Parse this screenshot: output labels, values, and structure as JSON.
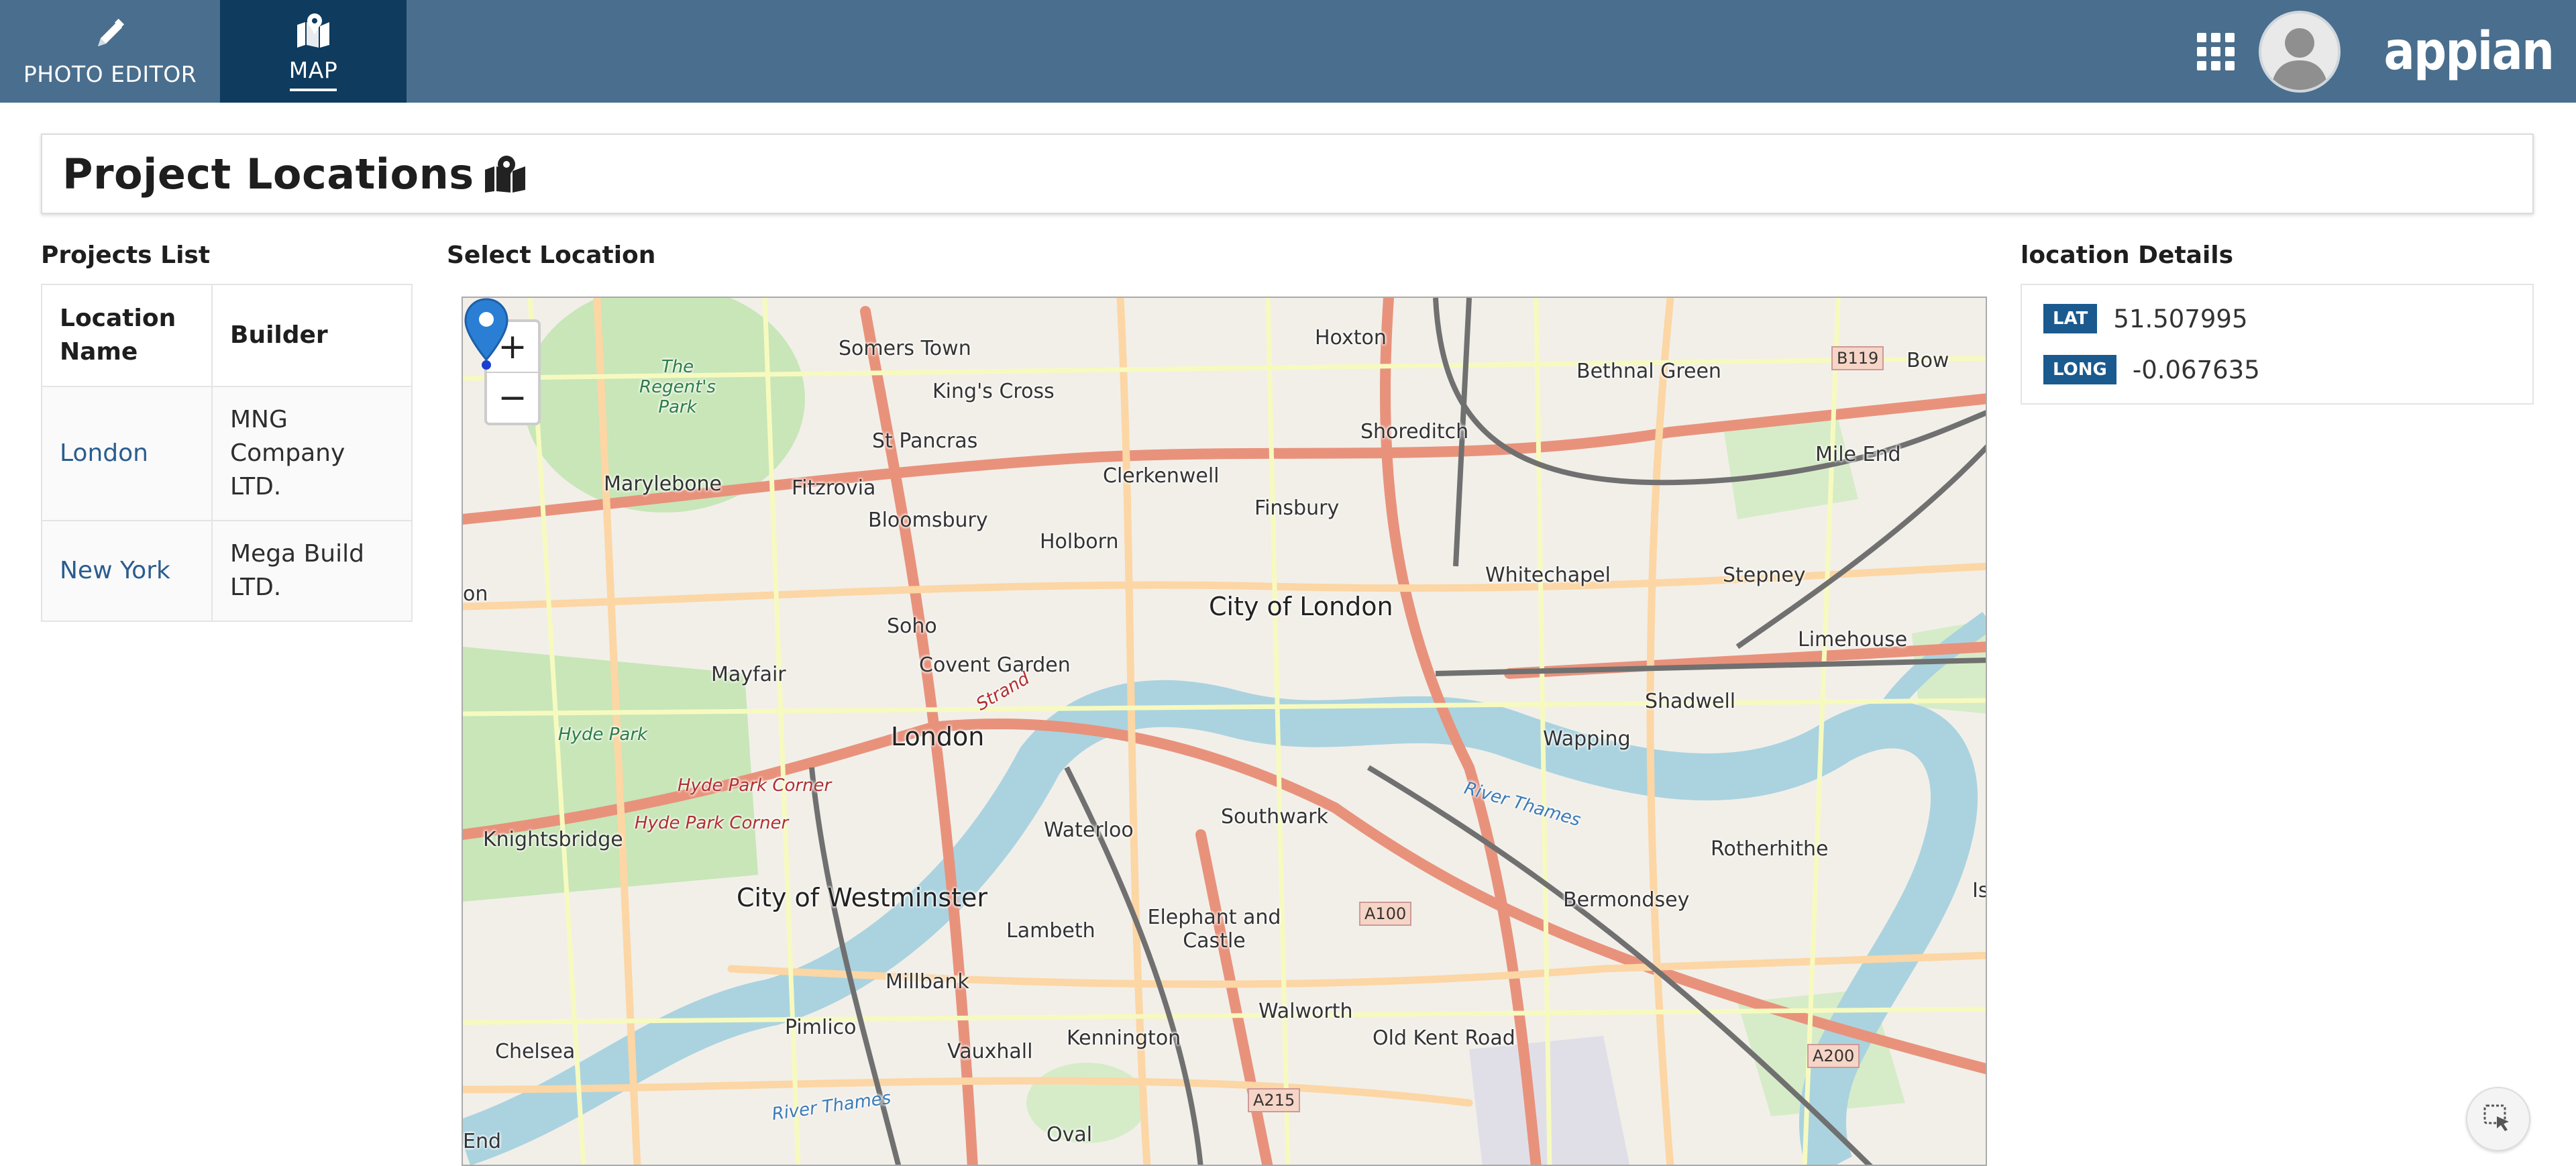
{
  "nav": {
    "tabs": [
      {
        "label": "PHOTO EDITOR",
        "icon": "pencil-icon"
      },
      {
        "label": "MAP",
        "icon": "map-icon",
        "active": true
      }
    ],
    "apps_icon": "grid-icon",
    "logo_text": "appian"
  },
  "page": {
    "title": "Project Locations"
  },
  "projects": {
    "section_label": "Projects List",
    "columns": [
      "Location Name",
      "Builder"
    ],
    "rows": [
      {
        "location": "London",
        "builder": "MNG Company LTD."
      },
      {
        "location": "New York",
        "builder": "Mega Build LTD."
      }
    ]
  },
  "map": {
    "section_label": "Select Location",
    "zoom_in": "+",
    "zoom_out": "−",
    "labels": {
      "somers_town": "Somers Town",
      "hoxton": "Hoxton",
      "bethnal_green": "Bethnal Green",
      "bow": "Bow",
      "kings_cross": "King's Cross",
      "regents_park": "The Regent's Park",
      "shoreditch": "Shoreditch",
      "st_pancras": "St Pancras",
      "mile_end": "Mile End",
      "marylebone": "Marylebone",
      "fitzrovia": "Fitzrovia",
      "clerkenwell": "Clerkenwell",
      "finsbury": "Finsbury",
      "bloomsbury": "Bloomsbury",
      "holborn": "Holborn",
      "whitechapel": "Whitechapel",
      "stepney": "Stepney",
      "soho": "Soho",
      "city_of_london": "City of London",
      "limehouse": "Limehouse",
      "mayfair": "Mayfair",
      "covent_garden": "Covent Garden",
      "shadwell": "Shadwell",
      "hyde_park": "Hyde Park",
      "london": "London",
      "wapping": "Wapping",
      "hyde_park_corner": "Hyde Park Corner",
      "hyde_park_corner_2": "Hyde Park Corner",
      "southwark": "Southwark",
      "rotherhithe": "Rotherhithe",
      "knightsbridge": "Knightsbridge",
      "waterloo": "Waterloo",
      "city_of_westminster": "City of Westminster",
      "elephant_and_castle": "Elephant and Castle",
      "bermondsey": "Bermondsey",
      "lambeth": "Lambeth",
      "millbank": "Millbank",
      "walworth": "Walworth",
      "pimlico": "Pimlico",
      "chelsea": "Chelsea",
      "vauxhall": "Vauxhall",
      "kennington": "Kennington",
      "old_kent_road": "Old Kent Road",
      "oval": "Oval",
      "river_thames": "River Thames",
      "river_thames_2": "River Thames",
      "strand": "Strand",
      "end": "End",
      "on": "on",
      "is": "Is",
      "b119": "B119",
      "a100": "A100",
      "a200": "A200",
      "a215": "A215"
    }
  },
  "details": {
    "section_label": "location Details",
    "lat_label": "LAT",
    "lat_value": "51.507995",
    "long_label": "LONG",
    "long_value": "-0.067635"
  },
  "colors": {
    "topbar": "#4a6e8d",
    "active_tab": "#0e3b5e",
    "badge": "#1b5a8e",
    "link": "#2a5d8f",
    "marker": "#2a7fd4"
  }
}
